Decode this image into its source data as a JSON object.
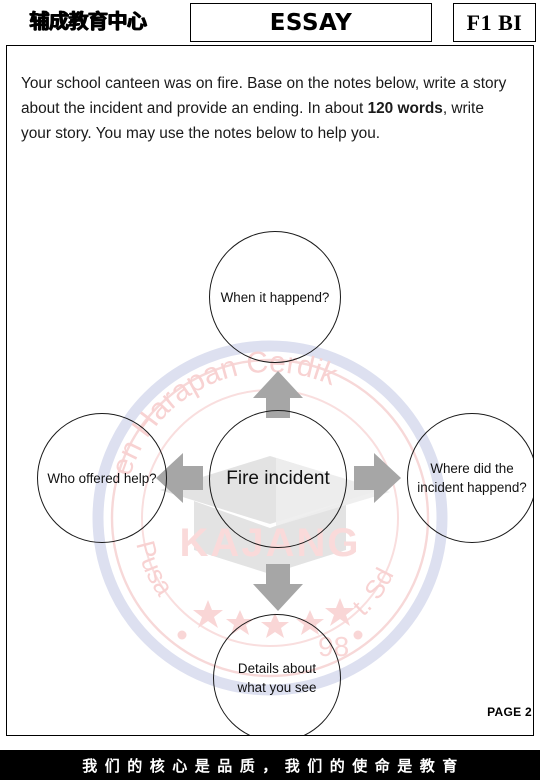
{
  "header": {
    "logo_text": "辅成教育中心",
    "title": "ESSAY",
    "code": "F1 BI"
  },
  "instructions": {
    "part1": "Your school canteen was on fire. Base on the notes below, write a story about the incident and provide an ending. In about ",
    "emphasis": "120 words",
    "part2": ", write your story. You may use the notes below to help you."
  },
  "diagram": {
    "type": "bubble-map",
    "center": "Fire incident",
    "top": "When it happend?",
    "left": "Who offered help?",
    "right": "Where did the incident happend?",
    "bottom": "Details about what you see",
    "arrow_color": "#A6A6A6"
  },
  "watermark": {
    "top_text": "en Hara",
    "top_text2": "rdik",
    "center_text": "KAJANG",
    "left_text": "Pusa",
    "right_text": "t. Sd",
    "number": "98",
    "ring_color": "#F7D5D5",
    "arc_color": "#DDE0F0"
  },
  "footer": {
    "page_label": "PAGE 2",
    "motto": "我们的核心是品质，我们的使命是教育"
  }
}
